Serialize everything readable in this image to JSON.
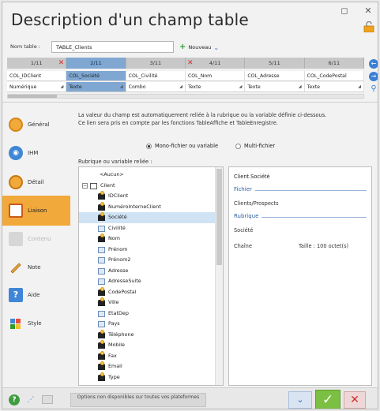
{
  "window": {
    "title": "Description d'un champ table"
  },
  "name_row": {
    "label": "Nom table :",
    "value": "TABLE_Clients",
    "new_label": "Nouveau"
  },
  "columns": {
    "numbers": [
      "1/11",
      "2/11",
      "3/11",
      "4/11",
      "5/11",
      "6/11"
    ],
    "names": [
      "COL_IDClient",
      "COL_Société",
      "COL_Civilité",
      "COL_Nom",
      "COL_Adresse",
      "COL_CodePostal"
    ],
    "types": [
      "Numérique",
      "Texte",
      "Combo",
      "Texte",
      "Texte",
      "Texte"
    ],
    "selected_index": 1
  },
  "sidebar": {
    "items": [
      {
        "label": "Général",
        "icon": "general-icon",
        "state": "normal"
      },
      {
        "label": "IHM",
        "icon": "eye-icon",
        "state": "normal"
      },
      {
        "label": "Détail",
        "icon": "detail-icon",
        "state": "normal"
      },
      {
        "label": "Liaison",
        "icon": "link-icon",
        "state": "active"
      },
      {
        "label": "Contenu",
        "icon": "content-icon",
        "state": "disabled"
      },
      {
        "label": "Note",
        "icon": "pencil-icon",
        "state": "normal"
      },
      {
        "label": "Aide",
        "icon": "help-question-icon",
        "state": "normal"
      },
      {
        "label": "Style",
        "icon": "style-icon",
        "state": "normal"
      }
    ]
  },
  "main": {
    "description_line1": "La valeur du champ est automatiquement reliée à la rubrique ou la variable définie ci-dessous.",
    "description_line2": "Ce lien sera pris en compte par les fonctions TableAffiche et TableEnregistre.",
    "radio_mono": "Mono-fichier ou variable",
    "radio_multi": "Multi-fichier",
    "tree_label": "Rubrique ou variable reliée :",
    "tree": [
      {
        "label": "<Aucun>",
        "icon": "none",
        "level": 1
      },
      {
        "label": "Client",
        "icon": "table",
        "level": 0,
        "expanded": true
      },
      {
        "label": "IDClient",
        "icon": "key",
        "level": 2
      },
      {
        "label": "NuméroInterneClient",
        "icon": "key",
        "level": 2
      },
      {
        "label": "Société",
        "icon": "key",
        "level": 2,
        "selected": true
      },
      {
        "label": "Civilité",
        "icon": "field",
        "level": 2
      },
      {
        "label": "Nom",
        "icon": "key",
        "level": 2
      },
      {
        "label": "Prénom",
        "icon": "field",
        "level": 2
      },
      {
        "label": "Prénom2",
        "icon": "field",
        "level": 2
      },
      {
        "label": "Adresse",
        "icon": "field",
        "level": 2
      },
      {
        "label": "AdresseSuite",
        "icon": "field",
        "level": 2
      },
      {
        "label": "CodePostal",
        "icon": "key",
        "level": 2
      },
      {
        "label": "Ville",
        "icon": "key",
        "level": 2
      },
      {
        "label": "EtatDep",
        "icon": "field",
        "level": 2
      },
      {
        "label": "Pays",
        "icon": "field",
        "level": 2
      },
      {
        "label": "Téléphone",
        "icon": "key",
        "level": 2
      },
      {
        "label": "Mobile",
        "icon": "key",
        "level": 2
      },
      {
        "label": "Fax",
        "icon": "key",
        "level": 2
      },
      {
        "label": "Email",
        "icon": "key",
        "level": 2
      },
      {
        "label": "Type",
        "icon": "key",
        "level": 2
      }
    ],
    "details": {
      "name": "Client.Société",
      "fichier_title": "Fichier",
      "fichier_value": "Clients/Prospects",
      "rubrique_title": "Rubrique",
      "rubrique_value": "Société",
      "type": "Chaîne",
      "size": "Taille : 100 octet(s)"
    }
  },
  "footer": {
    "platform_msg": "Options non disponibles sur toutes vos plateformes",
    "ok_icon": "check-icon",
    "cancel_icon": "x-icon"
  }
}
